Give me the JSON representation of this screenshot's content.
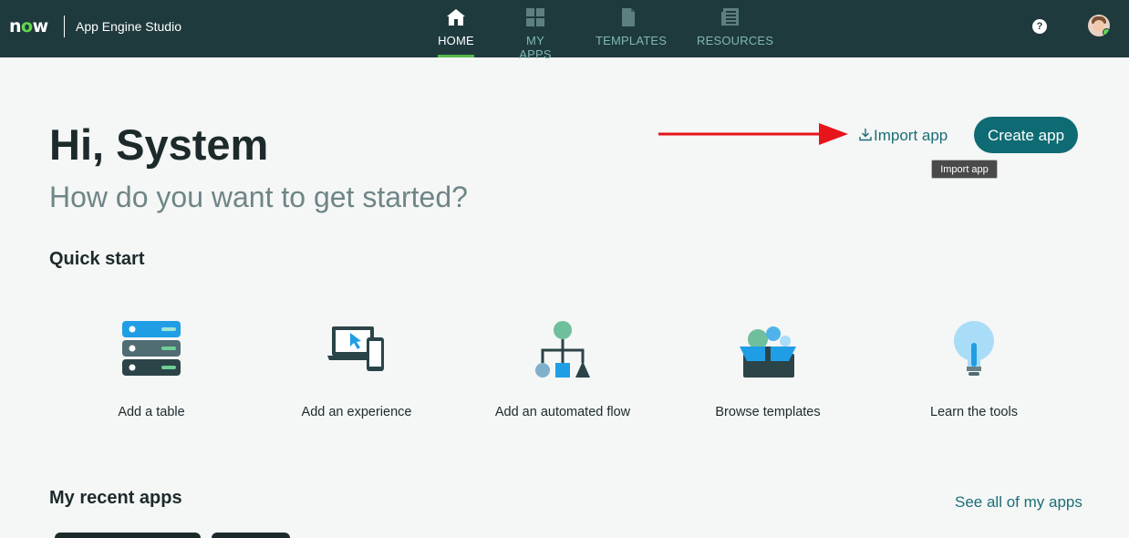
{
  "header": {
    "logo_text": "now",
    "app_name": "App Engine Studio",
    "nav": [
      {
        "label": "HOME",
        "icon": "home-icon",
        "active": true
      },
      {
        "label": "MY APPS",
        "icon": "grid-icon",
        "active": false
      },
      {
        "label": "TEMPLATES",
        "icon": "document-icon",
        "active": false
      },
      {
        "label": "RESOURCES",
        "icon": "newspaper-icon",
        "active": false
      }
    ],
    "help_label": "?"
  },
  "main": {
    "greeting": "Hi, System",
    "subtitle": "How do you want to get started?",
    "import_label": "Import app",
    "import_tooltip": "Import app",
    "create_label": "Create app",
    "quick_start": {
      "title": "Quick start",
      "items": [
        {
          "label": "Add a table",
          "icon": "table-icon"
        },
        {
          "label": "Add an experience",
          "icon": "devices-icon"
        },
        {
          "label": "Add an automated flow",
          "icon": "flow-icon"
        },
        {
          "label": "Browse templates",
          "icon": "templates-box-icon"
        },
        {
          "label": "Learn the tools",
          "icon": "lightbulb-icon"
        }
      ]
    },
    "recent": {
      "title": "My recent apps",
      "see_all": "See all of my apps"
    }
  },
  "colors": {
    "header_bg": "#1f3a3d",
    "accent": "#0f6b73",
    "link": "#1a6f76",
    "annotation_arrow": "#e8141b"
  }
}
